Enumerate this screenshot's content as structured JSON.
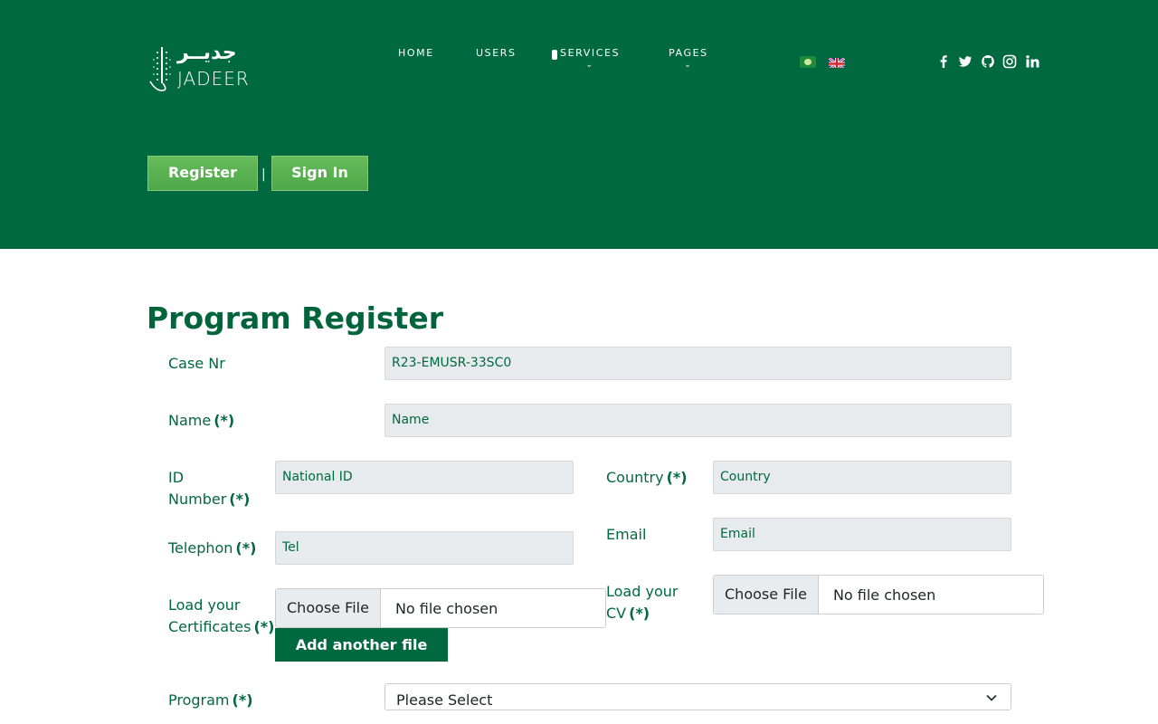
{
  "header": {
    "logo": {
      "arabic": "جديــر",
      "english": "JADEER"
    },
    "nav": [
      {
        "label": "HOME",
        "dropdown": false
      },
      {
        "label": "USERS",
        "dropdown": false
      },
      {
        "label": "SERVICES",
        "dropdown": true
      },
      {
        "label": "PAGES",
        "dropdown": true
      }
    ],
    "languages": [
      "arabic-flag-icon",
      "english-flag-icon"
    ],
    "social": [
      "facebook-icon",
      "twitter-icon",
      "github-icon",
      "instagram-icon",
      "linkedin-icon"
    ],
    "auth": {
      "register": "Register",
      "separator": "|",
      "signin": "Sign In"
    }
  },
  "form": {
    "title": "Program Register",
    "required_marker": "(*)",
    "case_nr": {
      "label": "Case Nr",
      "value": "R23-EMUSR-33SC0"
    },
    "name": {
      "label": "Name",
      "placeholder": "Name"
    },
    "id_number": {
      "label_line1": "ID",
      "label_line2": "Number",
      "placeholder": "National ID"
    },
    "country": {
      "label": "Country",
      "placeholder": "Country"
    },
    "telephone": {
      "label": "Telephon",
      "placeholder": "Tel"
    },
    "email": {
      "label": "Email",
      "placeholder": "Email"
    },
    "certificates": {
      "label_line1": "Load your",
      "label_line2": "Certificates",
      "choose": "Choose File",
      "status": "No file chosen",
      "add_button": "Add another file"
    },
    "cv": {
      "label_line1": "Load your",
      "label_line2": "CV",
      "choose": "Choose File",
      "status": "No file chosen"
    },
    "program": {
      "label": "Program",
      "selected": "Please Select"
    }
  },
  "colors": {
    "header_bg": "#006940",
    "accent_green": "#5bb150",
    "text_green": "#006940",
    "input_bg": "#e7ebee"
  }
}
